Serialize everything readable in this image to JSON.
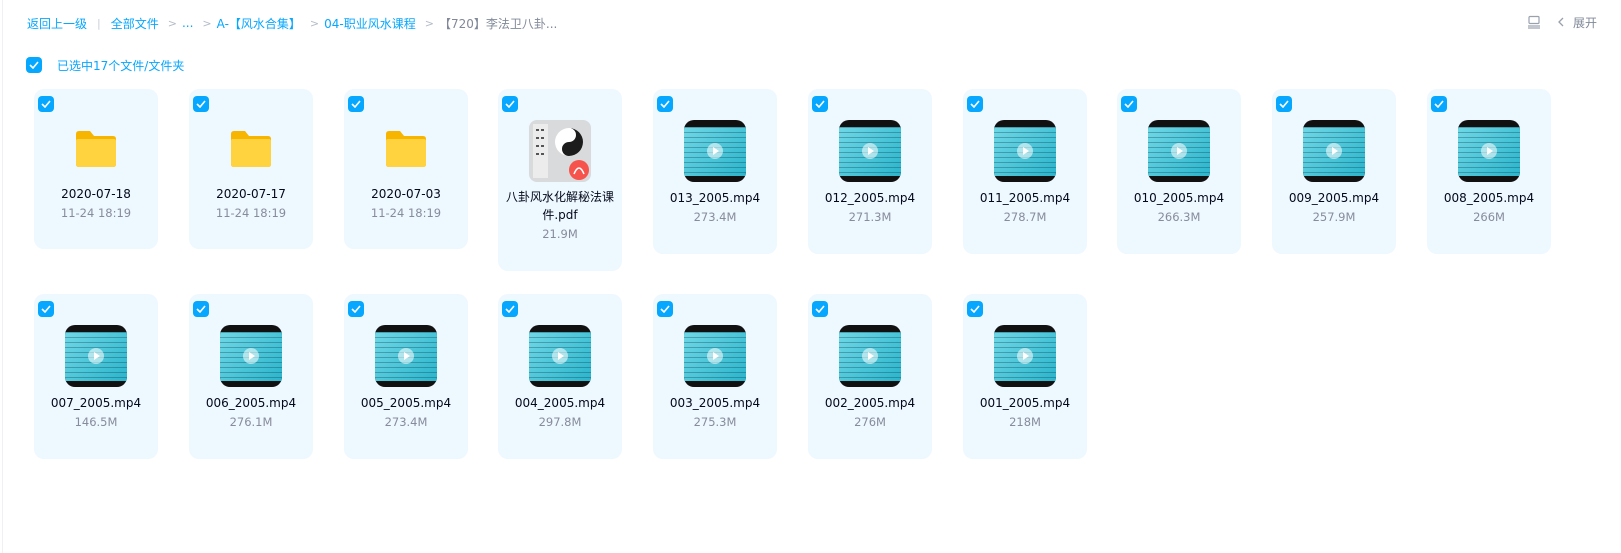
{
  "breadcrumb": {
    "back": "返回上一级",
    "all_files": "全部文件",
    "ellipsis": "...",
    "items": [
      "A-【风水合集】",
      "04-职业风水课程"
    ],
    "current": "【720】李法卫八卦..."
  },
  "toolbar": {
    "expand_label": "展开"
  },
  "selection": {
    "label": "已选中17个文件/文件夹"
  },
  "accent_color": "#06a7ff",
  "files": [
    {
      "type": "folder",
      "name": "2020-07-18",
      "meta": "11-24 18:19"
    },
    {
      "type": "folder",
      "name": "2020-07-17",
      "meta": "11-24 18:19"
    },
    {
      "type": "folder",
      "name": "2020-07-03",
      "meta": "11-24 18:19"
    },
    {
      "type": "pdf",
      "name": "八卦风水化解秘法课件.pdf",
      "meta": "21.9M"
    },
    {
      "type": "video",
      "name": "013_2005.mp4",
      "meta": "273.4M"
    },
    {
      "type": "video",
      "name": "012_2005.mp4",
      "meta": "271.3M"
    },
    {
      "type": "video",
      "name": "011_2005.mp4",
      "meta": "278.7M"
    },
    {
      "type": "video",
      "name": "010_2005.mp4",
      "meta": "266.3M"
    },
    {
      "type": "video",
      "name": "009_2005.mp4",
      "meta": "257.9M"
    },
    {
      "type": "video",
      "name": "008_2005.mp4",
      "meta": "266M"
    },
    {
      "type": "video",
      "name": "007_2005.mp4",
      "meta": "146.5M"
    },
    {
      "type": "video",
      "name": "006_2005.mp4",
      "meta": "276.1M"
    },
    {
      "type": "video",
      "name": "005_2005.mp4",
      "meta": "273.4M"
    },
    {
      "type": "video",
      "name": "004_2005.mp4",
      "meta": "297.8M"
    },
    {
      "type": "video",
      "name": "003_2005.mp4",
      "meta": "275.3M"
    },
    {
      "type": "video",
      "name": "002_2005.mp4",
      "meta": "276M"
    },
    {
      "type": "video",
      "name": "001_2005.mp4",
      "meta": "218M"
    }
  ]
}
